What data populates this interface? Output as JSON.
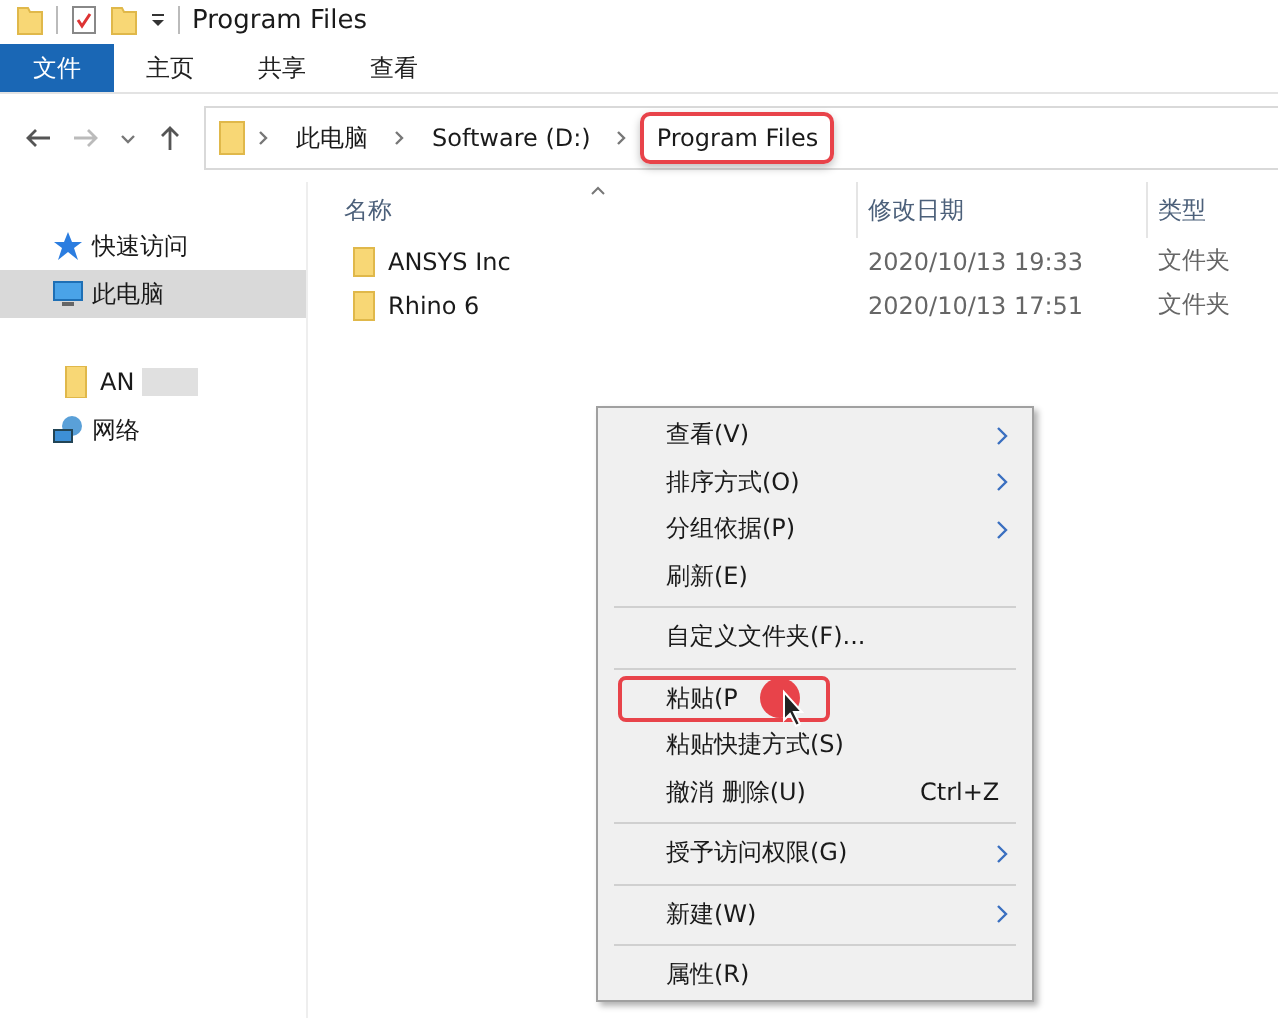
{
  "window": {
    "title": "Program Files"
  },
  "ribbon_tabs": [
    {
      "label": "文件",
      "selected": true
    },
    {
      "label": "主页",
      "selected": false
    },
    {
      "label": "共享",
      "selected": false
    },
    {
      "label": "查看",
      "selected": false
    }
  ],
  "breadcrumb": [
    {
      "label": "此电脑",
      "highlighted": false
    },
    {
      "label": "Software (D:)",
      "highlighted": false
    },
    {
      "label": "Program Files",
      "highlighted": true
    }
  ],
  "sidebar": {
    "items": [
      {
        "label": "快速访问",
        "selected": false
      },
      {
        "label": "此电脑",
        "selected": true
      },
      {
        "label": "AN",
        "selected": false
      },
      {
        "label": "网络",
        "selected": false
      }
    ]
  },
  "table": {
    "columns": [
      "名称",
      "修改日期",
      "类型"
    ],
    "rows": [
      {
        "name": "ANSYS Inc",
        "date": "2020/10/13 19:33",
        "type": "文件夹"
      },
      {
        "name": "Rhino 6",
        "date": "2020/10/13 17:51",
        "type": "文件夹"
      }
    ]
  },
  "context_menu": [
    {
      "kind": "item",
      "label": "查看(V)",
      "submenu": true,
      "highlighted": false
    },
    {
      "kind": "item",
      "label": "排序方式(O)",
      "submenu": true,
      "highlighted": false
    },
    {
      "kind": "item",
      "label": "分组依据(P)",
      "submenu": true,
      "highlighted": false
    },
    {
      "kind": "item",
      "label": "刷新(E)",
      "submenu": false,
      "highlighted": false
    },
    {
      "kind": "separator"
    },
    {
      "kind": "item",
      "label": "自定义文件夹(F)...",
      "submenu": false,
      "highlighted": false
    },
    {
      "kind": "separator"
    },
    {
      "kind": "item",
      "label": "粘贴(P",
      "submenu": false,
      "highlighted": true
    },
    {
      "kind": "item",
      "label": "粘贴快捷方式(S)",
      "submenu": false,
      "highlighted": false
    },
    {
      "kind": "item",
      "label": "撤消 删除(U)",
      "submenu": false,
      "highlighted": false,
      "shortcut": "Ctrl+Z"
    },
    {
      "kind": "separator"
    },
    {
      "kind": "item",
      "label": "授予访问权限(G)",
      "submenu": true,
      "highlighted": false
    },
    {
      "kind": "separator"
    },
    {
      "kind": "item",
      "label": "新建(W)",
      "submenu": true,
      "highlighted": false
    },
    {
      "kind": "separator"
    },
    {
      "kind": "item",
      "label": "属性(R)",
      "submenu": false,
      "highlighted": false
    }
  ]
}
